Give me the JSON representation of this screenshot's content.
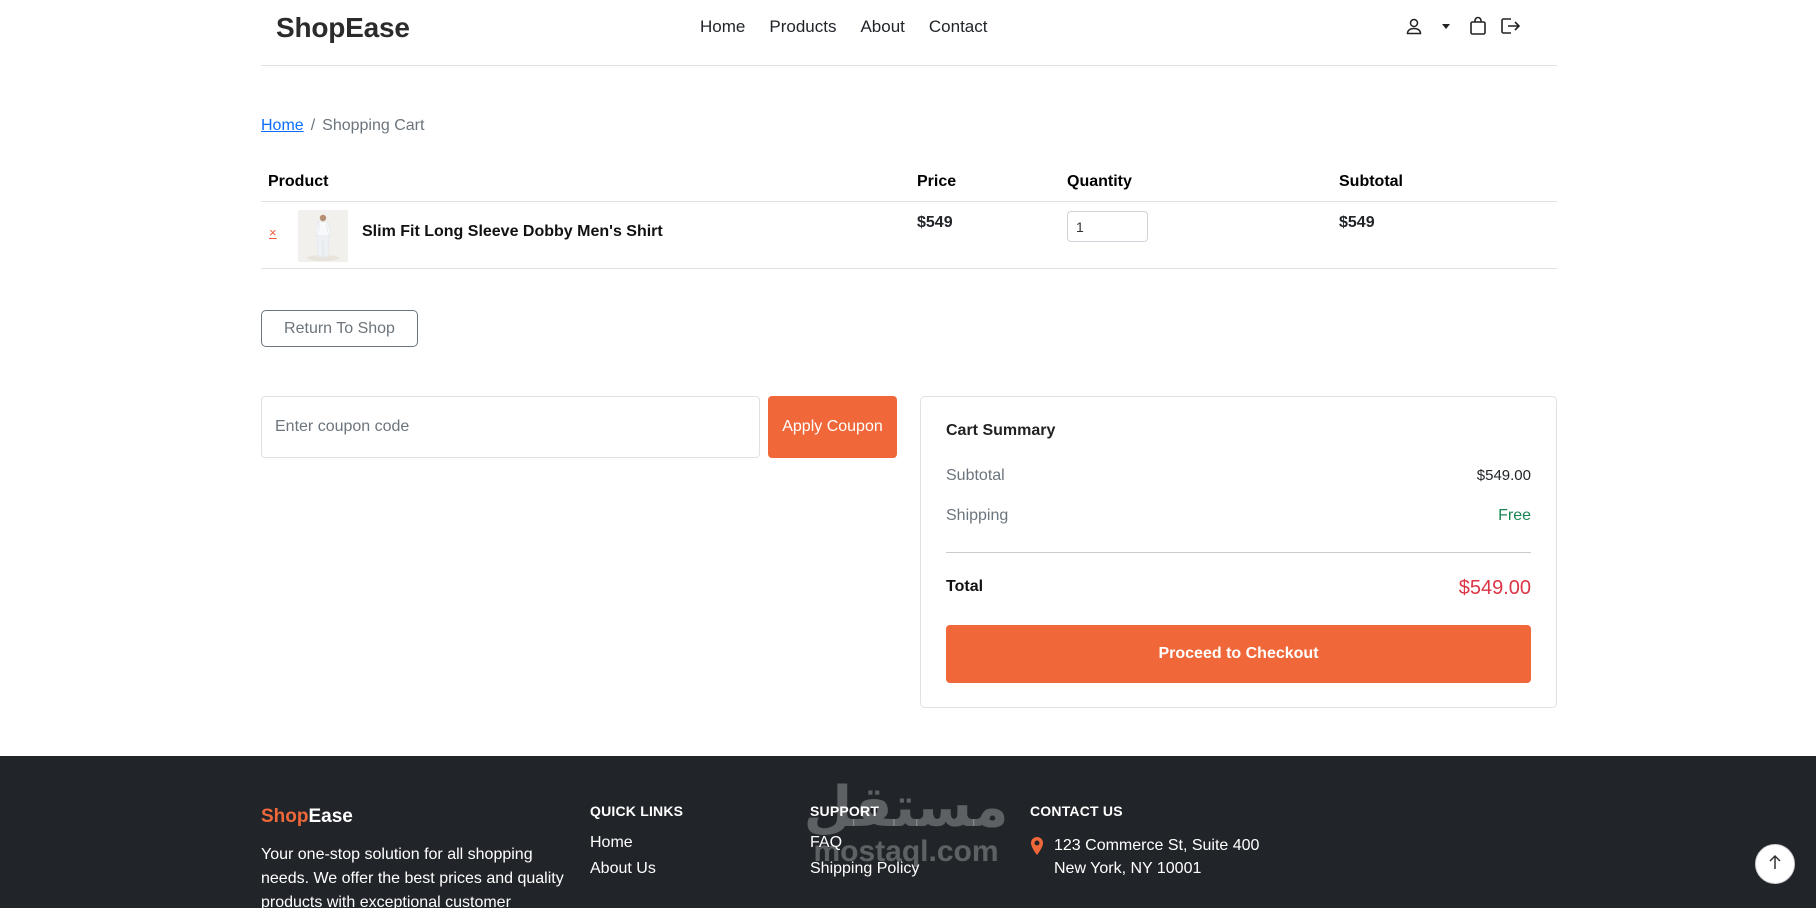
{
  "header": {
    "brand": "ShopEase",
    "nav": [
      "Home",
      "Products",
      "About",
      "Contact"
    ],
    "icons": [
      "user-icon",
      "caret-down-icon",
      "shopping-bag-icon",
      "logout-icon"
    ]
  },
  "breadcrumb": {
    "home": "Home",
    "separator": "/",
    "current": "Shopping Cart"
  },
  "cart": {
    "columns": {
      "product": "Product",
      "price": "Price",
      "quantity": "Quantity",
      "subtotal": "Subtotal"
    },
    "items": [
      {
        "remove": "×",
        "name": "Slim Fit Long Sleeve Dobby Men's Shirt",
        "price": "$549",
        "quantity": "1",
        "subtotal": "$549"
      }
    ],
    "return_label": "Return To Shop"
  },
  "coupon": {
    "placeholder": "Enter coupon code",
    "apply_label": "Apply Coupon"
  },
  "summary": {
    "title": "Cart Summary",
    "subtotal_label": "Subtotal",
    "subtotal_value": "$549.00",
    "shipping_label": "Shipping",
    "shipping_value": "Free",
    "total_label": "Total",
    "total_value": "$549.00",
    "checkout_label": "Proceed to Checkout"
  },
  "footer": {
    "brand_part1": "Shop",
    "brand_part2": "Ease",
    "description": "Your one-stop solution for all shopping needs. We offer the best prices and quality products with exceptional customer",
    "quick_links": {
      "title": "QUICK LINKS",
      "links": [
        "Home",
        "About Us"
      ]
    },
    "support": {
      "title": "SUPPORT",
      "links": [
        "FAQ",
        "Shipping Policy"
      ]
    },
    "contact": {
      "title": "CONTACT US",
      "address_line1": "123 Commerce St, Suite 400",
      "address_line2": "New York, NY 10001"
    }
  },
  "watermark": {
    "arabic": "مستقل",
    "latin": "mostaql.com"
  },
  "colors": {
    "accent": "#f0683a",
    "total": "#dc3545",
    "free": "#198754",
    "footer_bg": "#212529",
    "link": "#0d6efd"
  }
}
